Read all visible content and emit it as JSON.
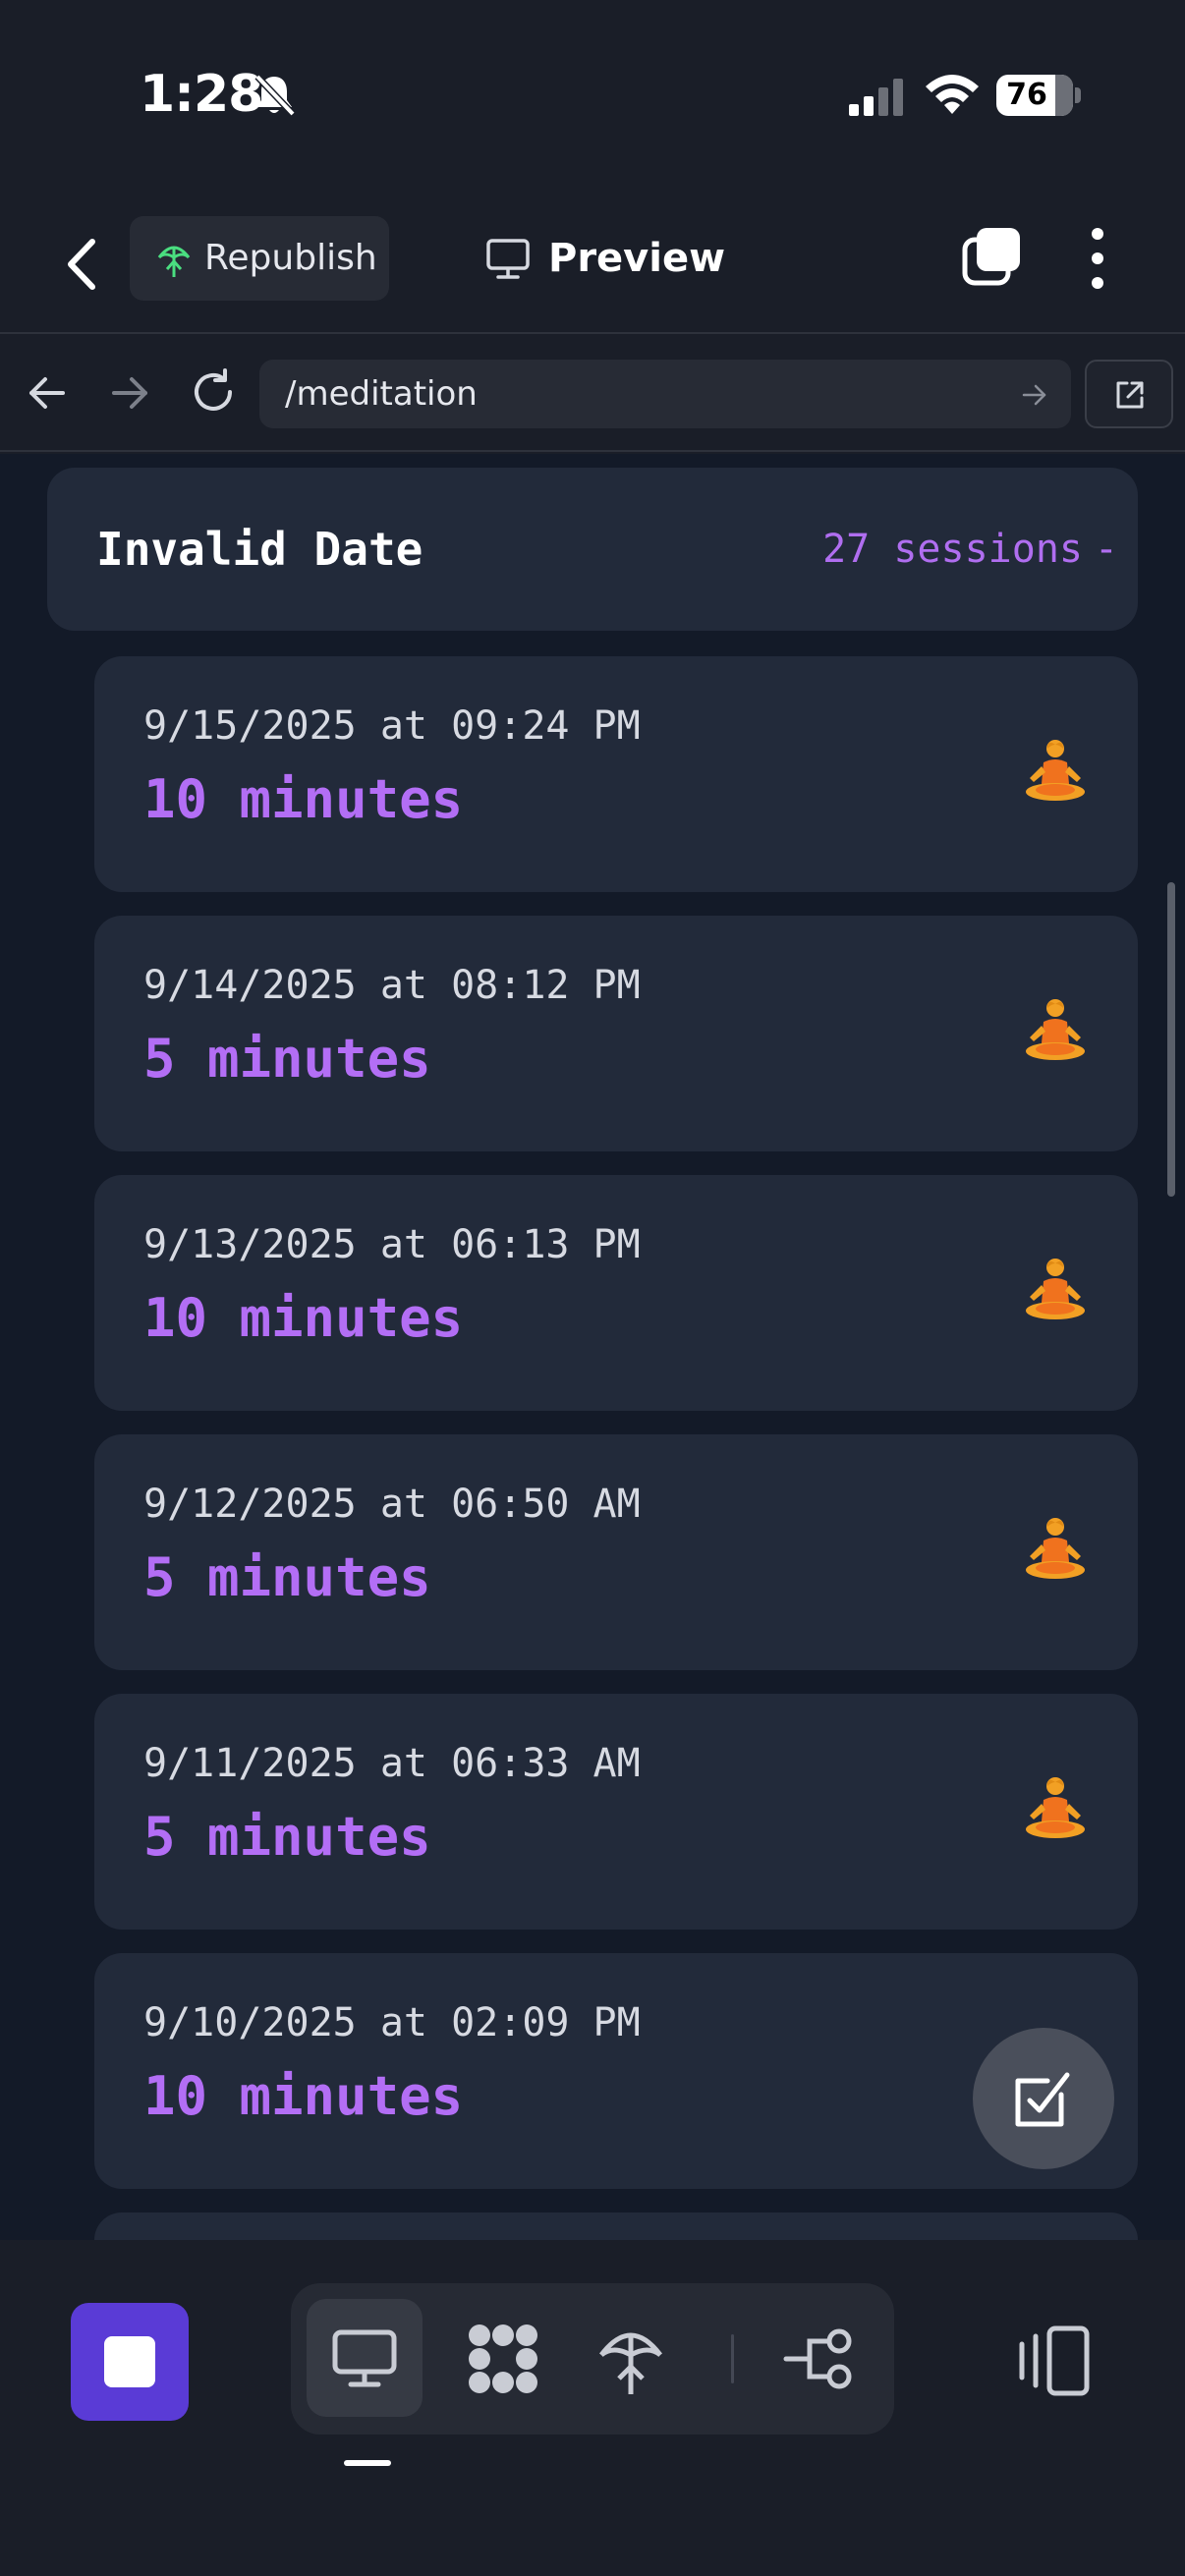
{
  "status_bar": {
    "time": "1:28",
    "battery": "76",
    "battery_level_percent": 76,
    "icons": [
      "bell-slash-icon",
      "cellular-signal-icon",
      "wifi-icon",
      "battery-icon"
    ]
  },
  "header": {
    "republish_label": "Republish",
    "preview_label": "Preview",
    "icons": [
      "chevron-left-icon",
      "republish-icon",
      "monitor-icon",
      "tabs-icon",
      "more-vertical-icon"
    ]
  },
  "url_bar": {
    "url": "/meditation",
    "icons": [
      "arrow-left-icon",
      "arrow-right-icon",
      "reload-icon",
      "go-arrow-icon",
      "open-external-icon"
    ]
  },
  "group": {
    "title": "Invalid Date",
    "count": "27 sessions",
    "toggle": "-"
  },
  "sessions": [
    {
      "date": "9/15/2025 at 09:24 PM",
      "duration": "10 minutes",
      "icon": "meditation-icon"
    },
    {
      "date": "9/14/2025 at 08:12 PM",
      "duration": "5 minutes",
      "icon": "meditation-icon"
    },
    {
      "date": "9/13/2025 at 06:13 PM",
      "duration": "10 minutes",
      "icon": "meditation-icon"
    },
    {
      "date": "9/12/2025 at 06:50 AM",
      "duration": "5 minutes",
      "icon": "meditation-icon"
    },
    {
      "date": "9/11/2025 at 06:33 AM",
      "duration": "5 minutes",
      "icon": "meditation-icon"
    },
    {
      "date": "9/10/2025 at 02:09 PM",
      "duration": "10 minutes",
      "icon": ""
    }
  ],
  "toolbar": {
    "icons": [
      "stop-icon",
      "monitor-icon",
      "apps-grid-icon",
      "deploy-icon",
      "connector-icon",
      "panel-icon"
    ]
  },
  "colors": {
    "accent_purple": "#b36ef5",
    "stop_button": "#5a3bd6",
    "card_background": "#222a3a",
    "content_background": "#131a28"
  }
}
